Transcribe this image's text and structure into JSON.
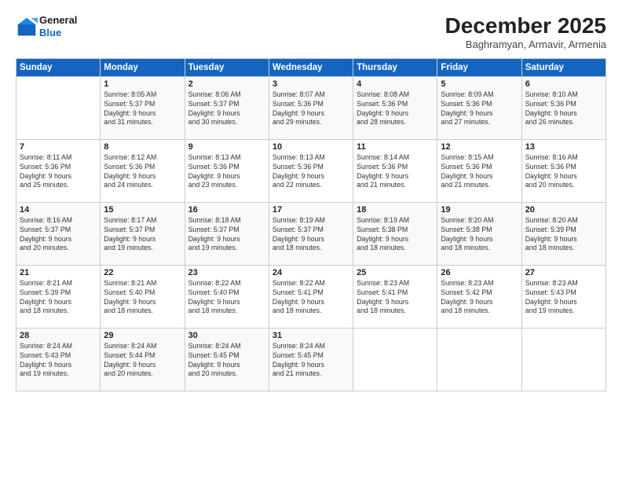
{
  "logo": {
    "line1": "General",
    "line2": "Blue"
  },
  "header": {
    "month": "December 2025",
    "location": "Baghramyan, Armavir, Armenia"
  },
  "weekdays": [
    "Sunday",
    "Monday",
    "Tuesday",
    "Wednesday",
    "Thursday",
    "Friday",
    "Saturday"
  ],
  "weeks": [
    [
      {
        "day": "",
        "info": ""
      },
      {
        "day": "1",
        "info": "Sunrise: 8:05 AM\nSunset: 5:37 PM\nDaylight: 9 hours\nand 31 minutes."
      },
      {
        "day": "2",
        "info": "Sunrise: 8:06 AM\nSunset: 5:37 PM\nDaylight: 9 hours\nand 30 minutes."
      },
      {
        "day": "3",
        "info": "Sunrise: 8:07 AM\nSunset: 5:36 PM\nDaylight: 9 hours\nand 29 minutes."
      },
      {
        "day": "4",
        "info": "Sunrise: 8:08 AM\nSunset: 5:36 PM\nDaylight: 9 hours\nand 28 minutes."
      },
      {
        "day": "5",
        "info": "Sunrise: 8:09 AM\nSunset: 5:36 PM\nDaylight: 9 hours\nand 27 minutes."
      },
      {
        "day": "6",
        "info": "Sunrise: 8:10 AM\nSunset: 5:36 PM\nDaylight: 9 hours\nand 26 minutes."
      }
    ],
    [
      {
        "day": "7",
        "info": "Sunrise: 8:11 AM\nSunset: 5:36 PM\nDaylight: 9 hours\nand 25 minutes."
      },
      {
        "day": "8",
        "info": "Sunrise: 8:12 AM\nSunset: 5:36 PM\nDaylight: 9 hours\nand 24 minutes."
      },
      {
        "day": "9",
        "info": "Sunrise: 8:13 AM\nSunset: 5:36 PM\nDaylight: 9 hours\nand 23 minutes."
      },
      {
        "day": "10",
        "info": "Sunrise: 8:13 AM\nSunset: 5:36 PM\nDaylight: 9 hours\nand 22 minutes."
      },
      {
        "day": "11",
        "info": "Sunrise: 8:14 AM\nSunset: 5:36 PM\nDaylight: 9 hours\nand 21 minutes."
      },
      {
        "day": "12",
        "info": "Sunrise: 8:15 AM\nSunset: 5:36 PM\nDaylight: 9 hours\nand 21 minutes."
      },
      {
        "day": "13",
        "info": "Sunrise: 8:16 AM\nSunset: 5:36 PM\nDaylight: 9 hours\nand 20 minutes."
      }
    ],
    [
      {
        "day": "14",
        "info": "Sunrise: 8:16 AM\nSunset: 5:37 PM\nDaylight: 9 hours\nand 20 minutes."
      },
      {
        "day": "15",
        "info": "Sunrise: 8:17 AM\nSunset: 5:37 PM\nDaylight: 9 hours\nand 19 minutes."
      },
      {
        "day": "16",
        "info": "Sunrise: 8:18 AM\nSunset: 5:37 PM\nDaylight: 9 hours\nand 19 minutes."
      },
      {
        "day": "17",
        "info": "Sunrise: 8:19 AM\nSunset: 5:37 PM\nDaylight: 9 hours\nand 18 minutes."
      },
      {
        "day": "18",
        "info": "Sunrise: 8:19 AM\nSunset: 5:38 PM\nDaylight: 9 hours\nand 18 minutes."
      },
      {
        "day": "19",
        "info": "Sunrise: 8:20 AM\nSunset: 5:38 PM\nDaylight: 9 hours\nand 18 minutes."
      },
      {
        "day": "20",
        "info": "Sunrise: 8:20 AM\nSunset: 5:39 PM\nDaylight: 9 hours\nand 18 minutes."
      }
    ],
    [
      {
        "day": "21",
        "info": "Sunrise: 8:21 AM\nSunset: 5:39 PM\nDaylight: 9 hours\nand 18 minutes."
      },
      {
        "day": "22",
        "info": "Sunrise: 8:21 AM\nSunset: 5:40 PM\nDaylight: 9 hours\nand 18 minutes."
      },
      {
        "day": "23",
        "info": "Sunrise: 8:22 AM\nSunset: 5:40 PM\nDaylight: 9 hours\nand 18 minutes."
      },
      {
        "day": "24",
        "info": "Sunrise: 8:22 AM\nSunset: 5:41 PM\nDaylight: 9 hours\nand 18 minutes."
      },
      {
        "day": "25",
        "info": "Sunrise: 8:23 AM\nSunset: 5:41 PM\nDaylight: 9 hours\nand 18 minutes."
      },
      {
        "day": "26",
        "info": "Sunrise: 8:23 AM\nSunset: 5:42 PM\nDaylight: 9 hours\nand 18 minutes."
      },
      {
        "day": "27",
        "info": "Sunrise: 8:23 AM\nSunset: 5:43 PM\nDaylight: 9 hours\nand 19 minutes."
      }
    ],
    [
      {
        "day": "28",
        "info": "Sunrise: 8:24 AM\nSunset: 5:43 PM\nDaylight: 9 hours\nand 19 minutes."
      },
      {
        "day": "29",
        "info": "Sunrise: 8:24 AM\nSunset: 5:44 PM\nDaylight: 9 hours\nand 20 minutes."
      },
      {
        "day": "30",
        "info": "Sunrise: 8:24 AM\nSunset: 5:45 PM\nDaylight: 9 hours\nand 20 minutes."
      },
      {
        "day": "31",
        "info": "Sunrise: 8:24 AM\nSunset: 5:45 PM\nDaylight: 9 hours\nand 21 minutes."
      },
      {
        "day": "",
        "info": ""
      },
      {
        "day": "",
        "info": ""
      },
      {
        "day": "",
        "info": ""
      }
    ]
  ]
}
